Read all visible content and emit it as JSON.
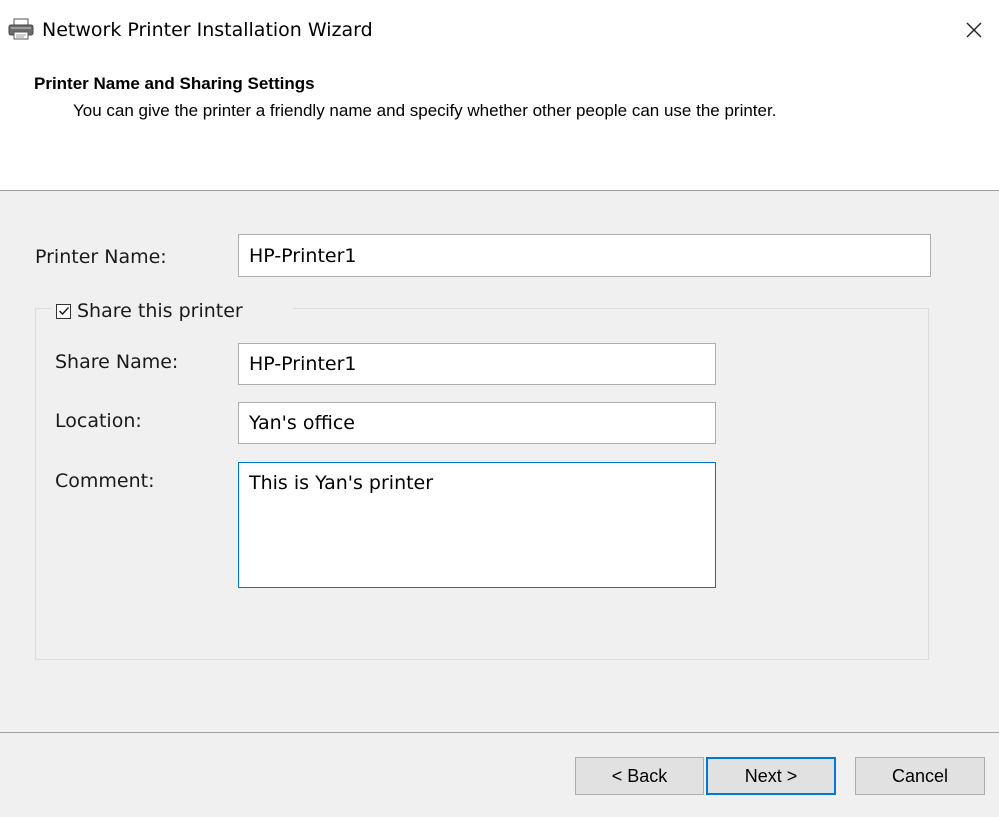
{
  "window": {
    "title": "Network Printer Installation Wizard",
    "icon": "printer-icon",
    "close_icon": "close-icon"
  },
  "header": {
    "title": "Printer Name and Sharing Settings",
    "subtitle": "You can give the printer a friendly name and specify whether other people can use the printer."
  },
  "form": {
    "printer_name_label": "Printer Name:",
    "printer_name_value": "HP-Printer1",
    "share_checkbox_label": "Share this printer",
    "share_checked": true,
    "share_name_label": "Share Name:",
    "share_name_value": "HP-Printer1",
    "location_label": "Location:",
    "location_value": "Yan's office",
    "comment_label": "Comment:",
    "comment_value": "This is Yan's printer"
  },
  "buttons": {
    "back": "< Back",
    "next": "Next >",
    "cancel": "Cancel"
  },
  "colors": {
    "focus_accent": "#0078d7",
    "window_bg": "#f0f0f0",
    "button_bg": "#e1e1e1"
  }
}
